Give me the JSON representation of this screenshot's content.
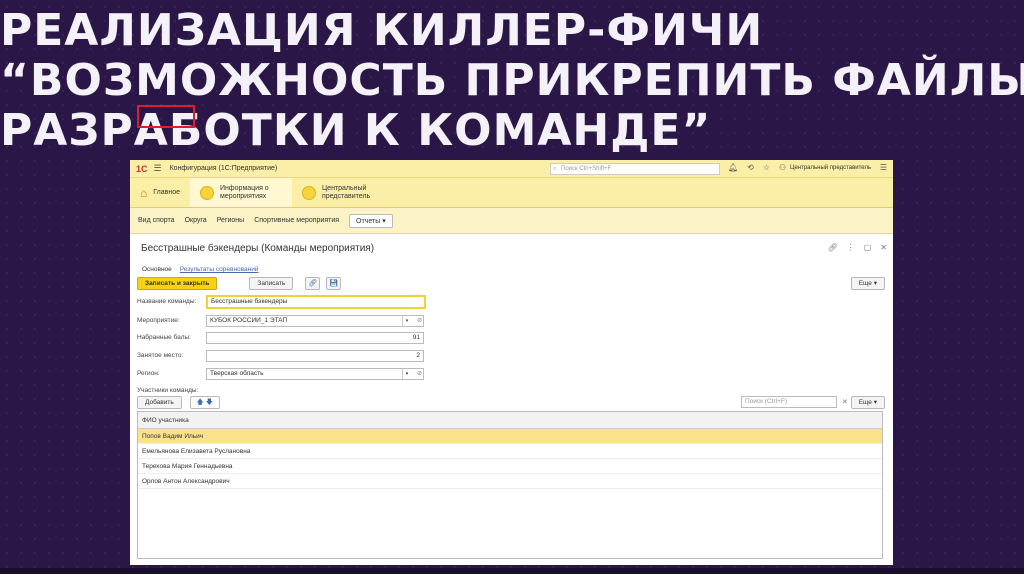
{
  "slide": {
    "title_lines": [
      "РЕАЛИЗАЦИЯ КИЛЛЕР-ФИЧИ",
      "“ВОЗМОЖНОСТЬ ПРИКРЕПИТЬ ФАЙЛЫ",
      "РАЗРАБОТКИ К КОМАНДЕ”"
    ]
  },
  "topbar": {
    "logo": "1С",
    "title": "Конфигурация (1С:Предприятие)",
    "search_placeholder": "Поиск Ctrl+Shift+F",
    "user": "Центральный представитель"
  },
  "sections": [
    {
      "label": "Главное"
    },
    {
      "label": "Информация о мероприятиях"
    },
    {
      "label": "Центральный представитель"
    }
  ],
  "nav": {
    "items": [
      "Вид спорта",
      "Округа",
      "Регионы",
      "Спортивные мероприятия"
    ],
    "reports": "Отчеты"
  },
  "form": {
    "title": "Бесстрашные бэкендеры (Команды мероприятия)",
    "tabs": [
      "Основное",
      "Результаты соревнований"
    ],
    "btn_save_close": "Записать и закрыть",
    "btn_save": "Записать",
    "btn_more": "Еще",
    "fields": {
      "team_name_label": "Название команды:",
      "team_name": "Бесстрашные бэкендеры",
      "event_label": "Мероприятие:",
      "event": "КУБОК РОССИИ_1 ЭТАП",
      "points_label": "Набранные балы:",
      "points": "91",
      "place_label": "Занятое место:",
      "place": "2",
      "region_label": "Регион:",
      "region": "Тверская область"
    },
    "members": {
      "label": "Участники команды:",
      "add": "Добавить",
      "search_placeholder": "Поиск (Ctrl+F)",
      "more": "Еще",
      "column": "ФИО участника",
      "rows": [
        "Попов Вадим Ильич",
        "Емельянова Елизавета Руслановна",
        "Терехова Мария Геннадьевна",
        "Орлов Антон Александрович"
      ]
    }
  },
  "colors": {
    "slide_bg": "#2a1748",
    "accent_yellow": "#f5d215",
    "panel_yellow": "#fbeea6",
    "highlight_red": "#e01e2a",
    "selected_row": "#fbe28b"
  }
}
